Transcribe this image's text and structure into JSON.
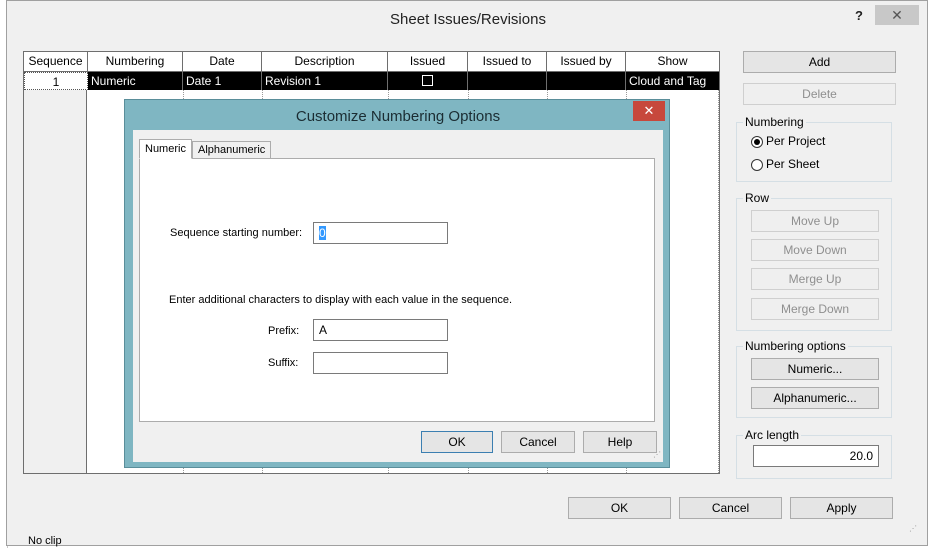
{
  "dialog": {
    "title": "Sheet Issues/Revisions",
    "help_label": "?",
    "close_label": "✕"
  },
  "table": {
    "columns": [
      "Sequence",
      "Numbering",
      "Date",
      "Description",
      "Issued",
      "Issued to",
      "Issued by",
      "Show"
    ],
    "rows": [
      {
        "sequence": "1",
        "numbering": "Numeric",
        "date": "Date 1",
        "description": "Revision 1",
        "issued": false,
        "issued_to": "",
        "issued_by": "",
        "show": "Cloud and Tag"
      }
    ]
  },
  "right_panel": {
    "add_label": "Add",
    "delete_label": "Delete",
    "numbering_group": "Numbering",
    "per_project_label": "Per Project",
    "per_sheet_label": "Per Sheet",
    "numbering_selected": "Per Project",
    "row_group": "Row",
    "move_up_label": "Move Up",
    "move_down_label": "Move Down",
    "merge_up_label": "Merge Up",
    "merge_down_label": "Merge Down",
    "numbering_options_group": "Numbering options",
    "numeric_button": "Numeric...",
    "alphanumeric_button": "Alphanumeric...",
    "arc_length_group": "Arc length",
    "arc_length_value": "20.0"
  },
  "footer": {
    "ok_label": "OK",
    "cancel_label": "Cancel",
    "apply_label": "Apply"
  },
  "modal": {
    "title": "Customize Numbering Options",
    "close_label": "✕",
    "tabs": [
      "Numeric",
      "Alphanumeric"
    ],
    "active_tab": "Numeric",
    "sequence_start_label": "Sequence starting number:",
    "sequence_start_value": "0",
    "instructions": "Enter additional characters to display with each value in the sequence.",
    "prefix_label": "Prefix:",
    "prefix_value": "A",
    "suffix_label": "Suffix:",
    "suffix_value": "",
    "ok_label": "OK",
    "cancel_label": "Cancel",
    "help_label": "Help"
  },
  "background": {
    "bottom_text": "No clip"
  },
  "colors": {
    "modal_frame": "#7fb6c2",
    "modal_close": "#c7483c",
    "selected_row": "#000000"
  }
}
